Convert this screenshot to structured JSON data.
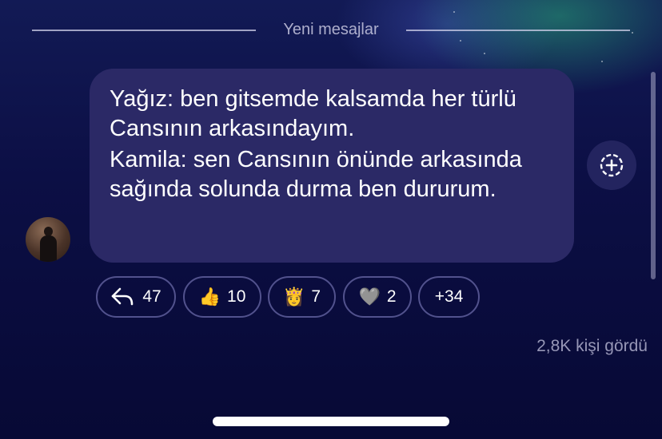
{
  "divider": {
    "label": "Yeni mesajlar"
  },
  "message": {
    "lines": [
      "Yağız: ben gitsemde kalsamda her türlü Cansının arkasındayım.",
      "Kamila: sen Cansının önünde arkasında sağında solunda durma ben dururum."
    ]
  },
  "reactions": [
    {
      "icon": "reply-arrow-icon",
      "count": "47"
    },
    {
      "icon": "thumbs-up-icon",
      "emoji": "👍",
      "count": "10"
    },
    {
      "icon": "princess-icon",
      "emoji": "👸",
      "count": "7"
    },
    {
      "icon": "grey-heart-icon",
      "emoji": "🩶",
      "count": "2"
    },
    {
      "label": "+34"
    }
  ],
  "views": "2,8K kişi gördü",
  "icons": {
    "add_reaction": "add-reaction-icon",
    "avatar": "user-avatar"
  }
}
